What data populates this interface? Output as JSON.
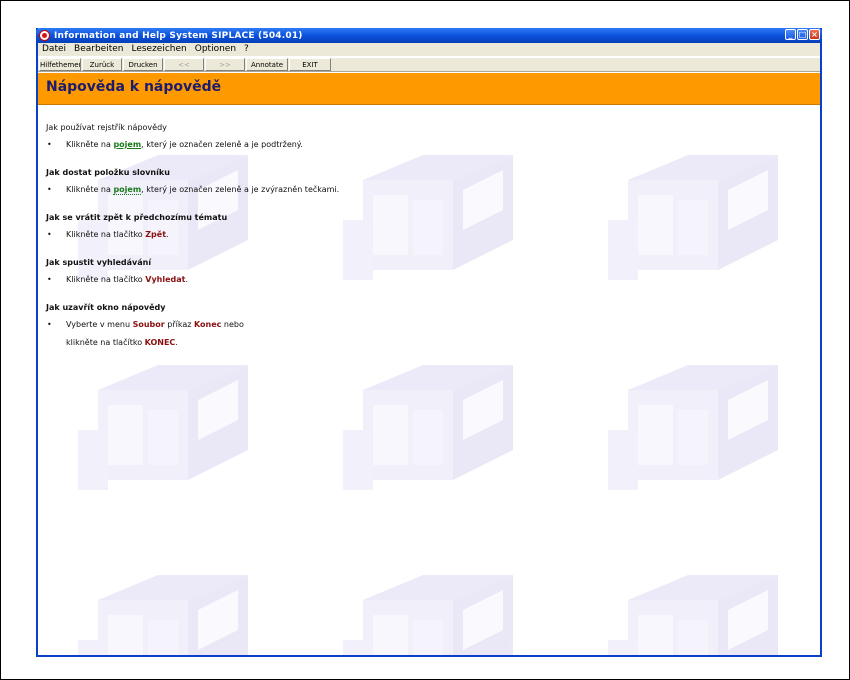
{
  "window": {
    "title": "Information and Help System SIPLACE (504.01)",
    "controls": {
      "minimize": "_",
      "maximize": "□",
      "close": "×"
    }
  },
  "menu": [
    "Datei",
    "Bearbeiten",
    "Lesezeichen",
    "Optionen",
    "?"
  ],
  "toolbar": [
    {
      "label": "Hilfethemen",
      "enabled": true
    },
    {
      "label": "Zurück",
      "enabled": true
    },
    {
      "label": "Drucken",
      "enabled": true
    },
    {
      "label": "<<",
      "enabled": false
    },
    {
      "label": ">>",
      "enabled": false
    },
    {
      "label": "Annotate",
      "enabled": true
    },
    {
      "label": "EXIT",
      "enabled": true
    }
  ],
  "page": {
    "title": "Nápověda k nápovědě",
    "sections": [
      {
        "heading": "Jak používat rejstřík nápovědy",
        "heading_bold": false,
        "line1": {
          "pre": "Klikněte na ",
          "kw": "pojem",
          "post": ", který je označen zeleně a je podtržený."
        }
      },
      {
        "heading": "Jak dostat položku slovníku",
        "heading_bold": true,
        "line1": {
          "pre": "Klikněte na ",
          "kw": "pojem",
          "post": ", který je označen zeleně a je zvýrazněn tečkami."
        }
      },
      {
        "heading": "Jak se vrátit zpět k předchozímu tématu",
        "heading_bold": true,
        "line1": {
          "pre": "Klikněte na tlačítko ",
          "kw": "Zpět",
          "post": "."
        }
      },
      {
        "heading": "Jak spustit vyhledávání",
        "heading_bold": true,
        "line1": {
          "pre": "Klikněte na tlačítko ",
          "kw": "Vyhledat",
          "post": "."
        }
      },
      {
        "heading": "Jak uzavřít okno nápovědy",
        "heading_bold": true,
        "line1": {
          "pre": "Vyberte v menu ",
          "kw": "Soubor",
          "mid": " příkaz ",
          "kw2": "Konec",
          "post": " nebo"
        },
        "line2": {
          "pre": "klikněte na tlačítko ",
          "kw": "KONEC",
          "post": "."
        }
      }
    ]
  },
  "colors": {
    "titlebar": "#0a4fd9",
    "header_band": "#ff9900",
    "title_text": "#1c1c6e",
    "keyword_green": "#1a7a1a",
    "keyword_red": "#8a1010"
  },
  "icons": [
    "app-icon",
    "minimize-icon",
    "maximize-icon",
    "close-icon",
    "machine-watermark"
  ]
}
